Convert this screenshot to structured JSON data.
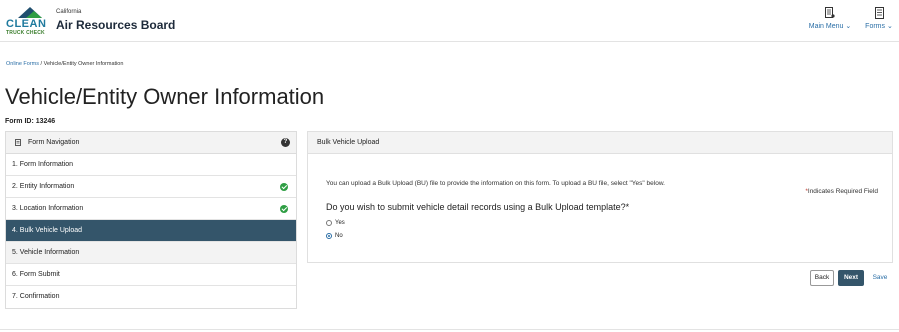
{
  "header": {
    "logo": {
      "line1": "CLEAN",
      "line2": "TRUCK CHECK"
    },
    "brand_small": "California",
    "brand_big": "Air Resources Board",
    "menu_main": "Main Menu ⌄",
    "menu_forms": "Forms ⌄"
  },
  "breadcrumb": {
    "home": "Online Forms",
    "separator": "/",
    "current": "Vehicle/Entity Owner Information"
  },
  "page_title": "Vehicle/Entity Owner Information",
  "form_id": "Form ID: 13246",
  "nav": {
    "title": "Form Navigation",
    "help": "?",
    "items": [
      {
        "label": "1. Form Information"
      },
      {
        "label": "2. Entity Information"
      },
      {
        "label": "3. Location Information"
      },
      {
        "label": "4. Bulk Vehicle Upload"
      },
      {
        "label": "5. Vehicle Information"
      },
      {
        "label": "6. Form Submit"
      },
      {
        "label": "7. Confirmation"
      }
    ]
  },
  "content": {
    "title": "Bulk Vehicle Upload",
    "info": "You can upload a Bulk Upload (BU) file to provide the information on this form. To upload a BU file, select \"Yes\" below.",
    "required_star": "*",
    "required_note": "Indicates Required Field",
    "question": "Do you wish to submit vehicle detail records using a Bulk Upload template?*",
    "option_yes": "Yes",
    "option_no": "No"
  },
  "buttons": {
    "back": "Back",
    "next": "Next",
    "save": "Save"
  },
  "colors": {
    "accent": "#34556a",
    "link": "#2a6ea6",
    "success": "#2f9e44"
  }
}
